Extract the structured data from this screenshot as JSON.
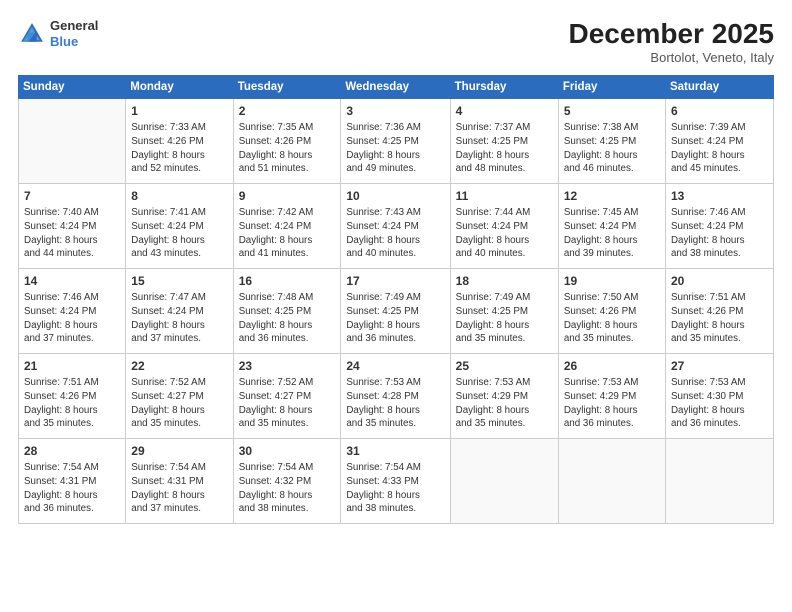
{
  "header": {
    "logo_general": "General",
    "logo_blue": "Blue",
    "month": "December 2025",
    "location": "Bortolot, Veneto, Italy"
  },
  "weekdays": [
    "Sunday",
    "Monday",
    "Tuesday",
    "Wednesday",
    "Thursday",
    "Friday",
    "Saturday"
  ],
  "weeks": [
    [
      {
        "day": "",
        "info": ""
      },
      {
        "day": "1",
        "info": "Sunrise: 7:33 AM\nSunset: 4:26 PM\nDaylight: 8 hours\nand 52 minutes."
      },
      {
        "day": "2",
        "info": "Sunrise: 7:35 AM\nSunset: 4:26 PM\nDaylight: 8 hours\nand 51 minutes."
      },
      {
        "day": "3",
        "info": "Sunrise: 7:36 AM\nSunset: 4:25 PM\nDaylight: 8 hours\nand 49 minutes."
      },
      {
        "day": "4",
        "info": "Sunrise: 7:37 AM\nSunset: 4:25 PM\nDaylight: 8 hours\nand 48 minutes."
      },
      {
        "day": "5",
        "info": "Sunrise: 7:38 AM\nSunset: 4:25 PM\nDaylight: 8 hours\nand 46 minutes."
      },
      {
        "day": "6",
        "info": "Sunrise: 7:39 AM\nSunset: 4:24 PM\nDaylight: 8 hours\nand 45 minutes."
      }
    ],
    [
      {
        "day": "7",
        "info": "Sunrise: 7:40 AM\nSunset: 4:24 PM\nDaylight: 8 hours\nand 44 minutes."
      },
      {
        "day": "8",
        "info": "Sunrise: 7:41 AM\nSunset: 4:24 PM\nDaylight: 8 hours\nand 43 minutes."
      },
      {
        "day": "9",
        "info": "Sunrise: 7:42 AM\nSunset: 4:24 PM\nDaylight: 8 hours\nand 41 minutes."
      },
      {
        "day": "10",
        "info": "Sunrise: 7:43 AM\nSunset: 4:24 PM\nDaylight: 8 hours\nand 40 minutes."
      },
      {
        "day": "11",
        "info": "Sunrise: 7:44 AM\nSunset: 4:24 PM\nDaylight: 8 hours\nand 40 minutes."
      },
      {
        "day": "12",
        "info": "Sunrise: 7:45 AM\nSunset: 4:24 PM\nDaylight: 8 hours\nand 39 minutes."
      },
      {
        "day": "13",
        "info": "Sunrise: 7:46 AM\nSunset: 4:24 PM\nDaylight: 8 hours\nand 38 minutes."
      }
    ],
    [
      {
        "day": "14",
        "info": "Sunrise: 7:46 AM\nSunset: 4:24 PM\nDaylight: 8 hours\nand 37 minutes."
      },
      {
        "day": "15",
        "info": "Sunrise: 7:47 AM\nSunset: 4:24 PM\nDaylight: 8 hours\nand 37 minutes."
      },
      {
        "day": "16",
        "info": "Sunrise: 7:48 AM\nSunset: 4:25 PM\nDaylight: 8 hours\nand 36 minutes."
      },
      {
        "day": "17",
        "info": "Sunrise: 7:49 AM\nSunset: 4:25 PM\nDaylight: 8 hours\nand 36 minutes."
      },
      {
        "day": "18",
        "info": "Sunrise: 7:49 AM\nSunset: 4:25 PM\nDaylight: 8 hours\nand 35 minutes."
      },
      {
        "day": "19",
        "info": "Sunrise: 7:50 AM\nSunset: 4:26 PM\nDaylight: 8 hours\nand 35 minutes."
      },
      {
        "day": "20",
        "info": "Sunrise: 7:51 AM\nSunset: 4:26 PM\nDaylight: 8 hours\nand 35 minutes."
      }
    ],
    [
      {
        "day": "21",
        "info": "Sunrise: 7:51 AM\nSunset: 4:26 PM\nDaylight: 8 hours\nand 35 minutes."
      },
      {
        "day": "22",
        "info": "Sunrise: 7:52 AM\nSunset: 4:27 PM\nDaylight: 8 hours\nand 35 minutes."
      },
      {
        "day": "23",
        "info": "Sunrise: 7:52 AM\nSunset: 4:27 PM\nDaylight: 8 hours\nand 35 minutes."
      },
      {
        "day": "24",
        "info": "Sunrise: 7:53 AM\nSunset: 4:28 PM\nDaylight: 8 hours\nand 35 minutes."
      },
      {
        "day": "25",
        "info": "Sunrise: 7:53 AM\nSunset: 4:29 PM\nDaylight: 8 hours\nand 35 minutes."
      },
      {
        "day": "26",
        "info": "Sunrise: 7:53 AM\nSunset: 4:29 PM\nDaylight: 8 hours\nand 36 minutes."
      },
      {
        "day": "27",
        "info": "Sunrise: 7:53 AM\nSunset: 4:30 PM\nDaylight: 8 hours\nand 36 minutes."
      }
    ],
    [
      {
        "day": "28",
        "info": "Sunrise: 7:54 AM\nSunset: 4:31 PM\nDaylight: 8 hours\nand 36 minutes."
      },
      {
        "day": "29",
        "info": "Sunrise: 7:54 AM\nSunset: 4:31 PM\nDaylight: 8 hours\nand 37 minutes."
      },
      {
        "day": "30",
        "info": "Sunrise: 7:54 AM\nSunset: 4:32 PM\nDaylight: 8 hours\nand 38 minutes."
      },
      {
        "day": "31",
        "info": "Sunrise: 7:54 AM\nSunset: 4:33 PM\nDaylight: 8 hours\nand 38 minutes."
      },
      {
        "day": "",
        "info": ""
      },
      {
        "day": "",
        "info": ""
      },
      {
        "day": "",
        "info": ""
      }
    ]
  ]
}
